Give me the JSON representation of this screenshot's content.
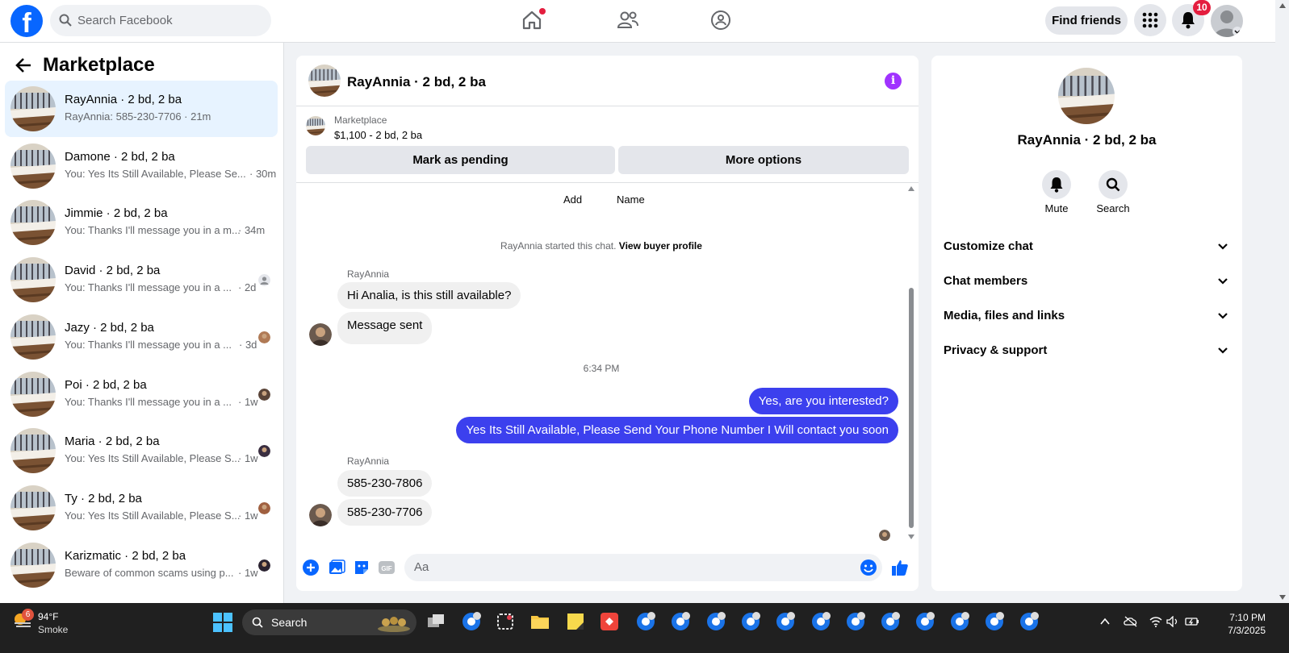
{
  "topbar": {
    "logo": "f",
    "search_placeholder": "Search Facebook",
    "find_friends": "Find friends",
    "notification_count": "10",
    "icons": [
      "home-icon",
      "friends-icon",
      "groups-icon",
      "menu-grid-icon",
      "bell-icon"
    ]
  },
  "sidebar": {
    "title": "Marketplace",
    "conversations": [
      {
        "name": "RayAnnia · 2 bd, 2 ba",
        "preview": "RayAnnia: 585-230-7706 · 21m",
        "time": "",
        "active": true
      },
      {
        "name": "Damone · 2 bd, 2 ba",
        "preview": "You: Yes Its Still Available, Please Se...",
        "time": "· 30m"
      },
      {
        "name": "Jimmie · 2 bd, 2 ba",
        "preview": "You: Thanks I'll message you in a m...",
        "time": "· 34m"
      },
      {
        "name": "David · 2 bd, 2 ba",
        "preview": "You: Thanks I'll message you in a ...",
        "time": "· 2d"
      },
      {
        "name": "Jazy · 2 bd, 2 ba",
        "preview": "You: Thanks I'll message you in a ...",
        "time": "· 3d"
      },
      {
        "name": "Poi · 2 bd, 2 ba",
        "preview": "You: Thanks I'll message you in a ...",
        "time": "· 1w"
      },
      {
        "name": "Maria · 2 bd, 2 ba",
        "preview": "You: Yes Its Still Available, Please S...",
        "time": "· 1w"
      },
      {
        "name": "Ty · 2 bd, 2 ba",
        "preview": "You: Yes Its Still Available, Please S...",
        "time": "· 1w"
      },
      {
        "name": "Karizmatic · 2 bd, 2 ba",
        "preview": "Beware of common scams using p...",
        "time": "· 1w"
      }
    ]
  },
  "chat": {
    "title": "RayAnnia · 2 bd, 2 ba",
    "listing_label": "Marketplace",
    "listing_price": "$1,100 - 2 bd, 2 ba",
    "mark_pending": "Mark as pending",
    "more_options": "More options",
    "add_label": "Add",
    "name_label": "Name",
    "started_text": "RayAnnia started this chat.",
    "view_profile": "View buyer profile",
    "sender_name": "RayAnnia",
    "msg1": "Hi Analia, is this still available?",
    "msg2": "Message sent",
    "timestamp": "6:34 PM",
    "out1": "Yes, are you interested?",
    "out2": "Yes Its Still Available, Please Send Your Phone Number I Will contact you soon",
    "msg3": "585-230-7806",
    "msg4": "585-230-7706",
    "composer_placeholder": "Aa",
    "gif_label": "GIF"
  },
  "right_panel": {
    "name": "RayAnnia · 2 bd, 2 ba",
    "mute": "Mute",
    "search": "Search",
    "sections": [
      "Customize chat",
      "Chat members",
      "Media, files and links",
      "Privacy & support"
    ]
  },
  "taskbar": {
    "weather_badge": "6",
    "temperature": "94°F",
    "condition": "Smoke",
    "search": "Search",
    "time": "7:10 PM",
    "date": "7/3/2025"
  },
  "colors": {
    "accent": "#0866ff",
    "outgoing_bubble": "#3c40ee",
    "active_conversation": "#e7f3ff",
    "info_icon": "#a033ff"
  }
}
